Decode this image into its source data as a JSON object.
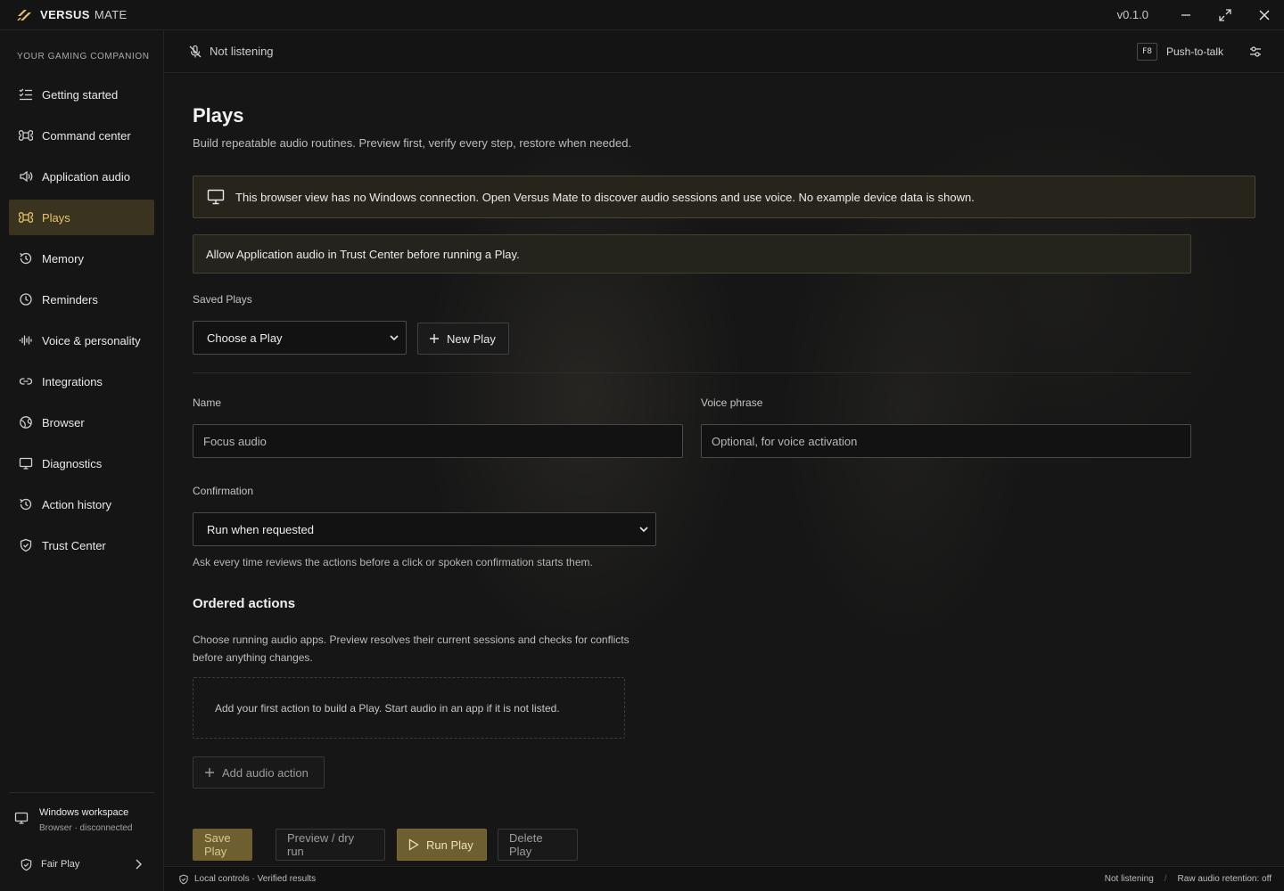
{
  "app": {
    "brand_name": "VERSUS",
    "brand_sub": "MATE",
    "version": "v0.1.0",
    "accent": "#e6c56a"
  },
  "sidebar": {
    "caption": "YOUR GAMING COMPANION",
    "items": [
      {
        "label": "Getting started",
        "icon": "checklist-icon"
      },
      {
        "label": "Command center",
        "icon": "command-icon"
      },
      {
        "label": "Application audio",
        "icon": "speaker-icon"
      },
      {
        "label": "Plays",
        "icon": "command-icon",
        "active": true
      },
      {
        "label": "Memory",
        "icon": "history-icon"
      },
      {
        "label": "Reminders",
        "icon": "clock-icon"
      },
      {
        "label": "Voice & personality",
        "icon": "waveform-icon"
      },
      {
        "label": "Integrations",
        "icon": "link-icon"
      },
      {
        "label": "Browser",
        "icon": "globe-icon"
      },
      {
        "label": "Diagnostics",
        "icon": "monitor-icon"
      },
      {
        "label": "Action history",
        "icon": "history-icon"
      },
      {
        "label": "Trust Center",
        "icon": "shield-icon"
      }
    ],
    "workspace_title": "Windows workspace",
    "workspace_status": "Browser · disconnected",
    "fair_play": "Fair Play"
  },
  "topbar": {
    "listen_status": "Not listening",
    "ptt_key": "F8",
    "ptt_label": "Push-to-talk"
  },
  "main": {
    "title": "Plays",
    "subtitle": "Build repeatable audio routines. Preview first, verify every step, restore when needed.",
    "notice": "This browser view has no Windows connection. Open Versus Mate to discover audio sessions and use voice. No example device data is shown.",
    "warning": "Allow Application audio in Trust Center before running a Play.",
    "saved_plays_label": "Saved Plays",
    "saved_plays_value": "Choose a Play",
    "new_play_label": "New Play",
    "name_label": "Name",
    "name_placeholder": "Focus audio",
    "voice_label": "Voice phrase",
    "voice_placeholder": "Optional, for voice activation",
    "confirmation_label": "Confirmation",
    "confirmation_value": "Run when requested",
    "confirmation_hint": "Ask every time reviews the actions before a click or spoken confirmation starts them.",
    "ordered_title": "Ordered actions",
    "ordered_desc": "Choose running audio apps. Preview resolves their current sessions and checks for conflicts before anything changes.",
    "empty_text": "Add your first action to build a Play. Start audio in an app if it is not listed.",
    "add_action_label": "Add audio action",
    "save_label": "Save Play",
    "preview_label": "Preview / dry run",
    "run_label": "Run Play",
    "delete_label": "Delete Play"
  },
  "statusbar": {
    "left": "Local controls · Verified results",
    "listening": "Not listening",
    "sep": "/",
    "retention": "Raw audio retention: off"
  }
}
